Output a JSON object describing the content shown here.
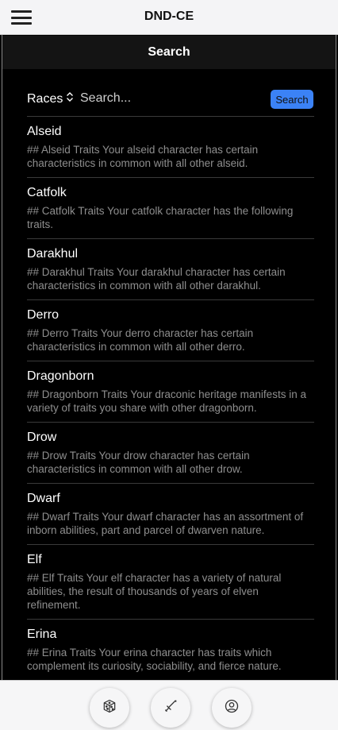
{
  "app": {
    "title": "DND-CE"
  },
  "header": {
    "title": "Search"
  },
  "search": {
    "category": "Races",
    "placeholder": "Search...",
    "button_label": "Search"
  },
  "results": [
    {
      "name": "Alseid",
      "description": "## Alseid Traits Your alseid character has certain characteristics in common with all other alseid."
    },
    {
      "name": "Catfolk",
      "description": "## Catfolk Traits Your catfolk character has the following traits."
    },
    {
      "name": "Darakhul",
      "description": "## Darakhul Traits Your darakhul character has certain characteristics in common with all other darakhul."
    },
    {
      "name": "Derro",
      "description": "## Derro Traits Your derro character has certain characteristics in common with all other derro."
    },
    {
      "name": "Dragonborn",
      "description": "## Dragonborn Traits Your draconic heritage manifests in a variety of traits you share with other dragonborn."
    },
    {
      "name": "Drow",
      "description": "## Drow Traits Your drow character has certain characteristics in common with all other drow."
    },
    {
      "name": "Dwarf",
      "description": "## Dwarf Traits Your dwarf character has an assortment of inborn abilities, part and parcel of dwarven nature."
    },
    {
      "name": "Elf",
      "description": "## Elf Traits Your elf character has a variety of natural abilities, the result of thousands of years of elven refinement."
    },
    {
      "name": "Erina",
      "description": "## Erina Traits Your erina character has traits which complement its curiosity, sociability, and fierce nature."
    }
  ],
  "bottom_nav": {
    "items": [
      {
        "icon": "dice-icon"
      },
      {
        "icon": "sword-icon"
      },
      {
        "icon": "user-circle-icon"
      }
    ]
  },
  "colors": {
    "accent": "#3b82f6",
    "background": "#000000",
    "header_bg": "#141414",
    "bar_bg": "#f4f4f6"
  }
}
